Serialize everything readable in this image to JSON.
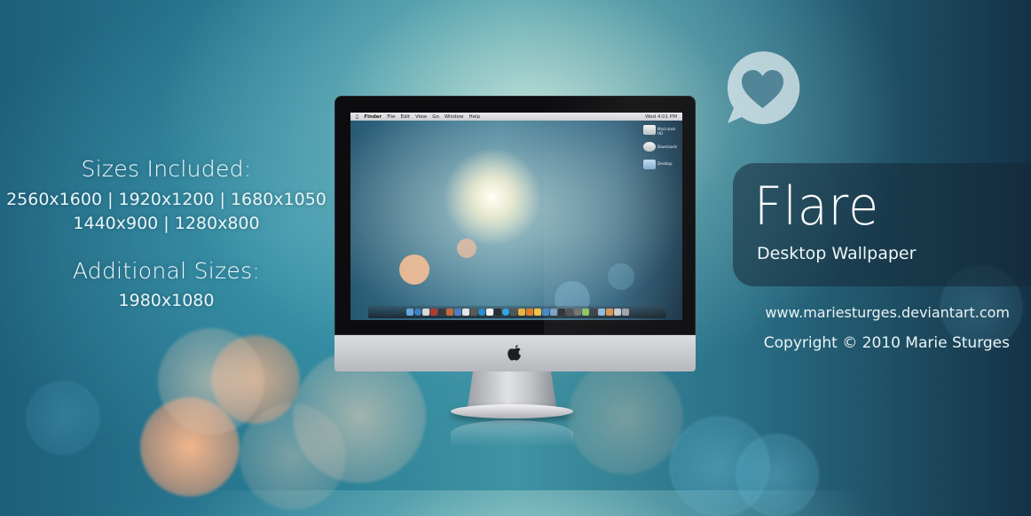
{
  "left_panel": {
    "sizes_heading": "Sizes Included:",
    "sizes_line1": "2560x1600 | 1920x1200 | 1680x1050",
    "sizes_line2": "1440x900 | 1280x800",
    "additional_heading": "Additional Sizes:",
    "additional_line": "1980x1080"
  },
  "title_panel": {
    "title": "Flare",
    "subtitle": "Desktop Wallpaper"
  },
  "footer": {
    "url": "www.mariesturges.deviantart.com",
    "copyright": "Copyright © 2010 Marie Sturges"
  },
  "screen_menubar": {
    "items": [
      "Finder",
      "File",
      "Edit",
      "View",
      "Go",
      "Window",
      "Help"
    ],
    "clock": "Wed 4:01 PM"
  },
  "screen_desktop_items": [
    "Macintosh HD",
    "Downloads",
    "Desktop"
  ],
  "icons": {
    "heart_bubble": "heart-speech-bubble-icon",
    "apple_logo": "apple-logo-icon"
  },
  "colors": {
    "panel_bg": "#14283780",
    "bokeh_orange": "#f8b98c",
    "text": "#ffffff"
  }
}
